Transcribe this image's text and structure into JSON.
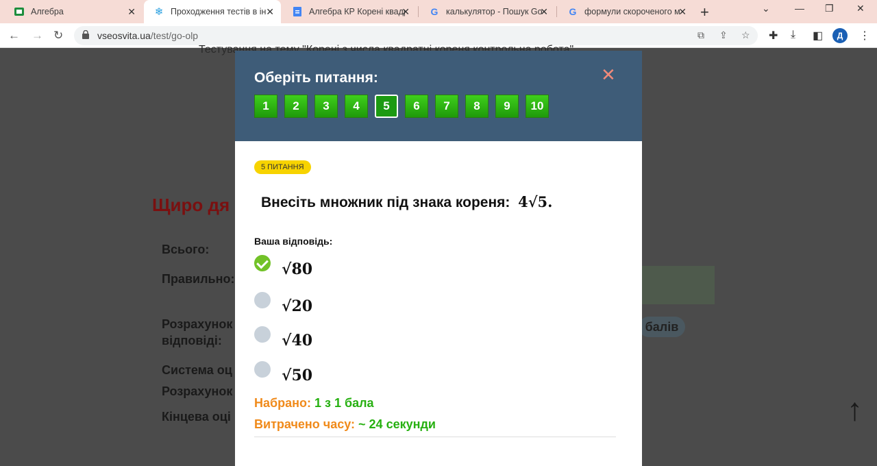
{
  "browser": {
    "tabs": [
      {
        "label": "Алгебра",
        "icon": "classroom-icon"
      },
      {
        "label": "Проходження тестів в ін",
        "icon": "snowflake-icon"
      },
      {
        "label": "Алгебра КР Корені квадр",
        "icon": "docs-icon"
      },
      {
        "label": "калькулятор - Пошук Go",
        "icon": "google-icon"
      },
      {
        "label": "формули скороченого м",
        "icon": "google-icon"
      }
    ],
    "new_tab": "+",
    "url_host": "vseosvita.ua",
    "url_path": "/test/go-olp",
    "avatar_letter": "Д"
  },
  "background_page": {
    "top_text": "Тестування на тему \"Корені з числа квадратні кореня контрольна робота\"",
    "title": "Щиро дя",
    "rows": [
      "Всього:",
      "Правильно:",
      "Розрахунок",
      "відповіді:",
      "Система оц",
      "Розрахунок",
      "Кінцева оці"
    ],
    "pill": "балів"
  },
  "modal": {
    "title": "Оберіть питання:",
    "close": "✕",
    "questions": [
      "1",
      "2",
      "3",
      "4",
      "5",
      "6",
      "7",
      "8",
      "9",
      "10"
    ],
    "current_question": 5,
    "badge": "5 ПИТАННЯ",
    "question_text": "Внесіть множник під знака кореня:",
    "question_math": "4√5.",
    "answer_label": "Ваша відповідь:",
    "options": [
      {
        "text": "√80",
        "selected": true
      },
      {
        "text": "√20",
        "selected": false
      },
      {
        "text": "√40",
        "selected": false
      },
      {
        "text": "√50",
        "selected": false
      }
    ],
    "score_key": "Набрано:",
    "score_value": "1 з 1 бала",
    "time_key": "Витрачено часу:",
    "time_value": "~ 24 секунди"
  },
  "colors": {
    "header": "#3e5c78",
    "accent_green": "#26b010",
    "accent_orange": "#f08a1a",
    "badge": "#f7d300"
  }
}
